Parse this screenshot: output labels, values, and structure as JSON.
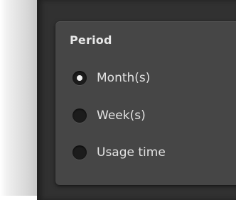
{
  "period_panel": {
    "title": "Period",
    "options": [
      {
        "label": "Month(s)",
        "checked": true
      },
      {
        "label": "Week(s)",
        "checked": false
      },
      {
        "label": "Usage time",
        "checked": false
      }
    ]
  },
  "colors": {
    "background_dark": "#313131",
    "card_background": "#464646",
    "radio_fill": "#1c1c1c",
    "text": "#e2e2e2"
  }
}
